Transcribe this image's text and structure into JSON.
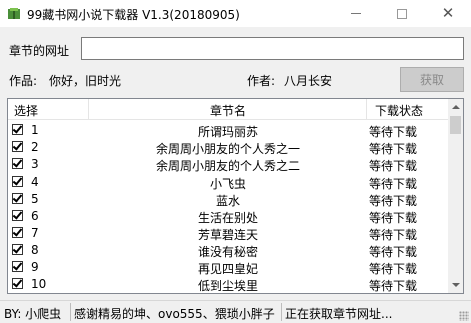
{
  "window": {
    "title": "99藏书网小说下载器 V1.3(20180905)"
  },
  "form": {
    "url_label": "章节的网址",
    "url_value": "",
    "work_label": "作品:",
    "work_value": "你好，旧时光",
    "author_label": "作者:",
    "author_value": "八月长安",
    "fetch_button": "获取"
  },
  "table": {
    "columns": [
      "选择",
      "章节名",
      "下载状态"
    ],
    "rows": [
      {
        "num": "1",
        "chapter": "所谓玛丽苏",
        "status": "等待下载"
      },
      {
        "num": "2",
        "chapter": "余周周小朋友的个人秀之一",
        "status": "等待下载"
      },
      {
        "num": "3",
        "chapter": "余周周小朋友的个人秀之二",
        "status": "等待下载"
      },
      {
        "num": "4",
        "chapter": "小飞虫",
        "status": "等待下载"
      },
      {
        "num": "5",
        "chapter": "蓝水",
        "status": "等待下载"
      },
      {
        "num": "6",
        "chapter": "生活在别处",
        "status": "等待下载"
      },
      {
        "num": "7",
        "chapter": "芳草碧连天",
        "status": "等待下载"
      },
      {
        "num": "8",
        "chapter": "谁没有秘密",
        "status": "等待下载"
      },
      {
        "num": "9",
        "chapter": "再见四皇妃",
        "status": "等待下载"
      },
      {
        "num": "10",
        "chapter": "低到尘埃里",
        "status": "等待下载"
      }
    ]
  },
  "statusbar": {
    "by": "BY: 小爬虫",
    "thanks": "感谢精易的坤、ovo555、猥琐小胖子",
    "status": "正在获取章节网址..."
  }
}
